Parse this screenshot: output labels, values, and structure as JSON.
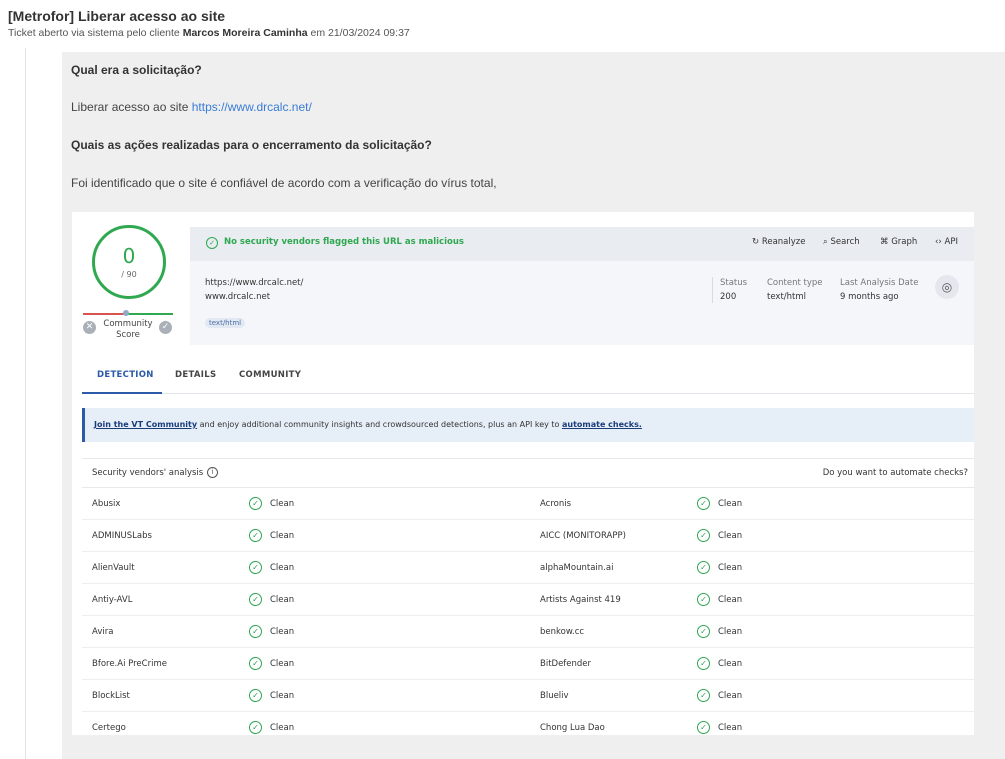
{
  "ticket": {
    "title": "[Metrofor] Liberar acesso ao site",
    "subtitle_prefix": "Ticket aberto via sistema pelo cliente",
    "client": "Marcos Moreira Caminha",
    "subtitle_suffix": "em 21/03/2024 09:37"
  },
  "message": {
    "q1": "Qual era a solicitação?",
    "a1_text": "Liberar acesso ao site",
    "a1_link": "https://www.drcalc.net/",
    "q2": "Quais as ações realizadas para o encerramento da solicitação?",
    "a2": "Foi identificado que o site é confiável de acordo com a verificação do vírus total,"
  },
  "vt": {
    "score": "0",
    "score_total": "/ 90",
    "community_score_label": "Community Score",
    "banner_text": "No security vendors flagged this URL as malicious",
    "tools": [
      {
        "icon": "↻",
        "label": "Reanalyze"
      },
      {
        "icon": "⌕",
        "label": "Search"
      },
      {
        "icon": "⌘",
        "label": "Graph"
      },
      {
        "icon": "‹›",
        "label": "API"
      }
    ],
    "url": "https://www.drcalc.net/",
    "domain": "www.drcalc.net",
    "content_tag": "text/html",
    "status_label": "Status",
    "status_value": "200",
    "content_type_label": "Content type",
    "content_type_value": "text/html",
    "last_analysis_label": "Last Analysis Date",
    "last_analysis_value": "9 months ago",
    "tabs": [
      "DETECTION",
      "DETAILS",
      "COMMUNITY"
    ],
    "cta_link1": "Join the VT Community",
    "cta_middle": " and enjoy additional community insights and crowdsourced detections, plus an API key to ",
    "cta_link2": "automate checks.",
    "vendors_title": "Security vendors' analysis",
    "vendors_right": "Do you want to automate checks?",
    "vendors": [
      {
        "left": "Abusix",
        "left_result": "Clean",
        "right": "Acronis",
        "right_result": "Clean"
      },
      {
        "left": "ADMINUSLabs",
        "left_result": "Clean",
        "right": "AICC (MONITORAPP)",
        "right_result": "Clean"
      },
      {
        "left": "AlienVault",
        "left_result": "Clean",
        "right": "alphaMountain.ai",
        "right_result": "Clean"
      },
      {
        "left": "Antiy-AVL",
        "left_result": "Clean",
        "right": "Artists Against 419",
        "right_result": "Clean"
      },
      {
        "left": "Avira",
        "left_result": "Clean",
        "right": "benkow.cc",
        "right_result": "Clean"
      },
      {
        "left": "Bfore.Ai PreCrime",
        "left_result": "Clean",
        "right": "BitDefender",
        "right_result": "Clean"
      },
      {
        "left": "BlockList",
        "left_result": "Clean",
        "right": "Blueliv",
        "right_result": "Clean"
      },
      {
        "left": "Certego",
        "left_result": "Clean",
        "right": "Chong Lua Dao",
        "right_result": "Clean"
      }
    ]
  }
}
